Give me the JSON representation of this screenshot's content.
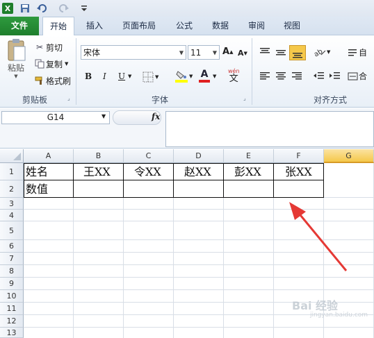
{
  "quick_access": {
    "app_icon": "excel-icon",
    "save_icon": "save-icon",
    "undo_icon": "undo-icon",
    "redo_icon": "redo-icon",
    "customize_icon": "customize-qat-icon"
  },
  "tabs": [
    {
      "label": "文件"
    },
    {
      "label": "开始"
    },
    {
      "label": "插入"
    },
    {
      "label": "页面布局"
    },
    {
      "label": "公式"
    },
    {
      "label": "数据"
    },
    {
      "label": "审阅"
    },
    {
      "label": "视图"
    }
  ],
  "clipboard": {
    "paste_label": "粘贴",
    "cut_label": "剪切",
    "copy_label": "复制",
    "format_painter_label": "格式刷",
    "group_label": "剪贴板"
  },
  "font": {
    "font_name": "宋体",
    "font_size": "11",
    "bold": "B",
    "italic": "I",
    "underline": "U",
    "phonetic": "wén",
    "group_label": "字体"
  },
  "alignment": {
    "group_label": "对齐方式",
    "wrap_label": "自",
    "merge_label": "合"
  },
  "formula_bar": {
    "name_box": "G14",
    "fx_label": "fx",
    "formula": ""
  },
  "grid": {
    "columns": [
      "A",
      "B",
      "C",
      "D",
      "E",
      "F",
      "G"
    ],
    "rows": [
      "1",
      "2",
      "3",
      "4",
      "5",
      "6",
      "7",
      "8",
      "9",
      "10",
      "11",
      "12",
      "13"
    ],
    "cells": {
      "A1": "姓名",
      "B1": "王XX",
      "C1": "令XX",
      "D1": "赵XX",
      "E1": "彭XX",
      "F1": "张XX",
      "A2": "数值"
    }
  },
  "watermark": {
    "text": "Bai 经验",
    "subtext": "jingyan.baidu.com"
  },
  "colors": {
    "file_tab": "#2a8d38",
    "selected_col": "#f5c84a",
    "arrow": "#e53935",
    "font_color": "#e02020",
    "highlight": "#ffff00"
  }
}
